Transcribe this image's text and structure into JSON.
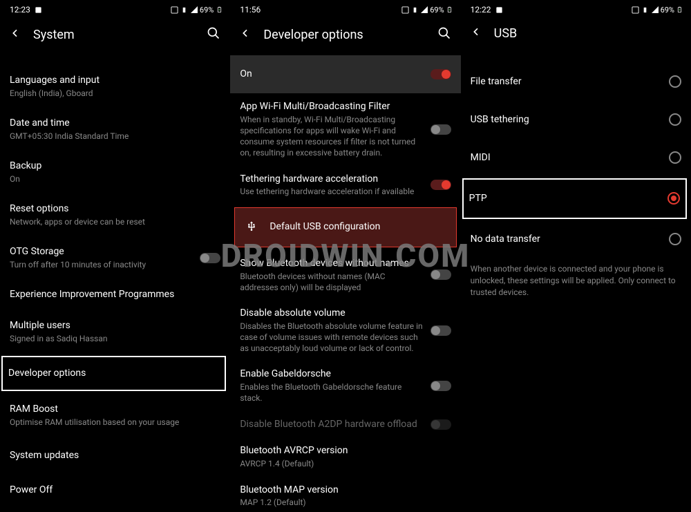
{
  "watermark": "DROIDWIN.COM",
  "panels": [
    {
      "status": {
        "time": "12:23",
        "battery": "69%"
      },
      "header": {
        "title": "System"
      },
      "items": {
        "lang": {
          "title": "Languages and input",
          "sub": "English (India), Gboard"
        },
        "date": {
          "title": "Date and time",
          "sub": "GMT+05:30 India Standard Time"
        },
        "backup": {
          "title": "Backup",
          "sub": "On"
        },
        "reset": {
          "title": "Reset options",
          "sub": "Network, apps or device can be reset"
        },
        "otg": {
          "title": "OTG Storage",
          "sub": "Turn off after 10 minutes of inactivity"
        },
        "exp": {
          "title": "Experience Improvement Programmes"
        },
        "multi": {
          "title": "Multiple users",
          "sub": "Signed in as Sadiq Hassan"
        },
        "dev": {
          "title": "Developer options"
        },
        "ram": {
          "title": "RAM Boost",
          "sub": "Optimise RAM utilisation based on your usage"
        },
        "upd": {
          "title": "System updates"
        },
        "pow": {
          "title": "Power Off"
        }
      }
    },
    {
      "status": {
        "time": "11:56",
        "battery": "69%"
      },
      "header": {
        "title": "Developer options"
      },
      "items": {
        "on": {
          "title": "On"
        },
        "wifi": {
          "title": "App Wi-Fi Multi/Broadcasting Filter",
          "sub": "When in standby, Wi-Fi Multi/Broadcasting specifications for apps will wake Wi-Fi and consume system resources if filter is not turned on, resulting in excessive battery drain."
        },
        "teth": {
          "title": "Tethering hardware acceleration",
          "sub": "Use tethering hardware acceleration if available"
        },
        "usb": {
          "title": "Default USB configuration"
        },
        "btnames": {
          "title": "Show Bluetooth devices without names",
          "sub": "Bluetooth devices without names (MAC addresses only) will be displayed"
        },
        "absvol": {
          "title": "Disable absolute volume",
          "sub": "Disables the Bluetooth absolute volume feature in case of volume issues with remote devices such as unacceptably loud volume or lack of control."
        },
        "gabel": {
          "title": "Enable Gabeldorsche",
          "sub": "Enables the Bluetooth Gabeldorsche feature stack."
        },
        "a2dp": {
          "title": "Disable Bluetooth A2DP hardware offload"
        },
        "avrcp": {
          "title": "Bluetooth AVRCP version",
          "sub": "AVRCP 1.4 (Default)"
        },
        "map": {
          "title": "Bluetooth MAP version",
          "sub": "MAP 1.2 (Default)"
        }
      }
    },
    {
      "status": {
        "time": "12:22",
        "battery": "69%"
      },
      "header": {
        "title": "USB"
      },
      "items": {
        "ft": {
          "title": "File transfer"
        },
        "tether": {
          "title": "USB tethering"
        },
        "midi": {
          "title": "MIDI"
        },
        "ptp": {
          "title": "PTP"
        },
        "nodata": {
          "title": "No data transfer"
        }
      },
      "note": "When another device is connected and your phone is unlocked, these settings will be applied. Only connect to trusted devices."
    }
  ]
}
